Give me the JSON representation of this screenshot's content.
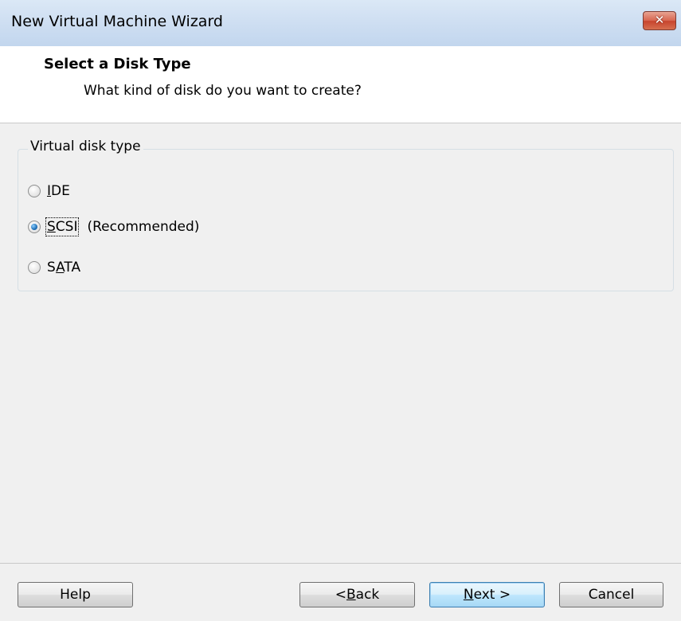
{
  "window": {
    "title": "New Virtual Machine Wizard"
  },
  "header": {
    "title": "Select a Disk Type",
    "subtitle": "What kind of disk do you want to create?"
  },
  "disk_type": {
    "group_label": "Virtual disk type",
    "options": [
      {
        "label_pre": "",
        "label_u": "I",
        "label_post": "DE",
        "note": "",
        "checked": false
      },
      {
        "label_pre": "",
        "label_u": "S",
        "label_post": "CSI",
        "note": "(Recommended)",
        "checked": true
      },
      {
        "label_pre": "S",
        "label_u": "A",
        "label_post": "TA",
        "note": "",
        "checked": false
      }
    ]
  },
  "buttons": {
    "help": "Help",
    "back_pre": "< ",
    "back_u": "B",
    "back_post": "ack",
    "next_u": "N",
    "next_post": "ext >",
    "cancel": "Cancel"
  }
}
